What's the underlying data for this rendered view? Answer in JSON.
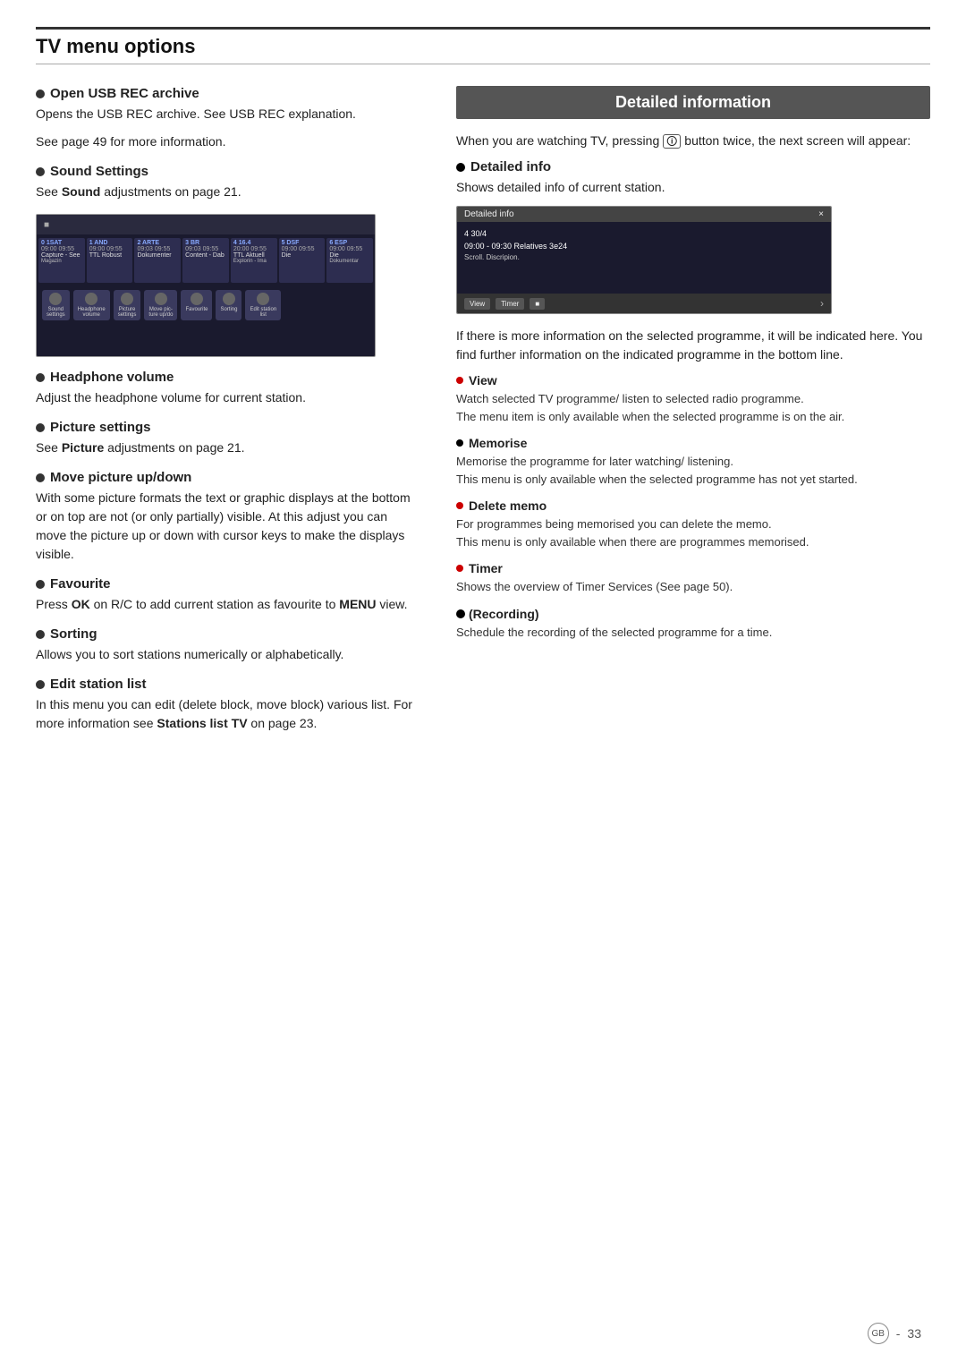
{
  "page": {
    "title": "TV menu options",
    "page_number": "33",
    "gb_label": "GB"
  },
  "left_column": {
    "open_usb": {
      "title": "Open USB REC archive",
      "text1": "Opens the USB REC archive. See USB REC explanation.",
      "text2": "See page 49 for more information."
    },
    "sound_settings": {
      "title": "Sound Settings",
      "text": "See Sound adjustments on page 21."
    },
    "headphone": {
      "title": "Headphone volume",
      "text": "Adjust the headphone volume for current station."
    },
    "picture_settings": {
      "title": "Picture settings",
      "text": "See Picture adjustments on page 21."
    },
    "move_picture": {
      "title": "Move picture up/down",
      "text": "With some picture formats the text or graphic displays at the bottom or on top are not (or only partially) visible. At this adjust you can move the picture up or down with cursor keys to make the displays visible."
    },
    "favourite": {
      "title": "Favourite",
      "text": "Press OK on R/C to add current station as favourite to MENU view.",
      "bold_word": "MENU"
    },
    "sorting": {
      "title": "Sorting",
      "text": "Allows you to sort stations numerically or alphabetically."
    },
    "edit_station": {
      "title": "Edit station list",
      "text1": "In this menu you can edit (delete block, move block) various list. For more information see ",
      "text_bold": "Stations list TV",
      "text2": " on page 23."
    },
    "tv_channels": [
      {
        "num": "0 1SAT",
        "time": "09:00 09:55",
        "sub": "Capture - See",
        "prog": "Magazin"
      },
      {
        "num": "1 AND",
        "time": "09:00 09:55",
        "sub": "TTL Robust",
        "prog": ""
      },
      {
        "num": "2 ARTE",
        "time": "09:03 09:55",
        "sub": "Dokumenter",
        "prog": ""
      },
      {
        "num": "3 BR",
        "time": "09:03 09:55",
        "sub": "Content - Dab",
        "prog": ""
      },
      {
        "num": "4 16.4",
        "time": "20:00 09:55",
        "sub": "TTL Aktuell",
        "prog": "Explorin- Ima"
      },
      {
        "num": "5 DSF",
        "time": "09:00 09:55",
        "sub": "Die",
        "prog": ""
      },
      {
        "num": "6 ESP",
        "time": "09:00 09:55",
        "sub": "Die",
        "prog": "Dokumentar"
      }
    ],
    "bottom_icons": [
      {
        "label": "Sound\nsettings"
      },
      {
        "label": "Headphone\nvolume"
      },
      {
        "label": "Picture\nsettings"
      },
      {
        "label": "Move pic-\nture up/do..."
      },
      {
        "label": "Favourite"
      },
      {
        "label": "Sorting"
      },
      {
        "label": "Edit station\nlist"
      }
    ]
  },
  "right_column": {
    "header": "Detailed information",
    "intro_text": "When you are watching TV, pressing  button twice, the next screen will appear:",
    "detailed_info": {
      "title": "Detailed info",
      "text": "Shows detailed info of current station.",
      "screen": {
        "titlebar": "Detailed info",
        "close": "×",
        "ch_number": "4 30/4",
        "time_info": "09:00 - 09:30 Relatives 3e24",
        "description": "Scroll. Discripion.",
        "btn1": "View",
        "btn2": "Timer",
        "arrow": "›"
      }
    },
    "more_info_text": "If there is more information on the selected programme, it will be indicated here. You find further information on the indicated programme in the bottom line.",
    "view": {
      "title": "View",
      "text1": "Watch selected TV programme/ listen to selected radio programme.",
      "text2": "The menu item is only available when the selected programme is on the air."
    },
    "memorise": {
      "title": "Memorise",
      "text1": "Memorise the programme for later watching/ listening.",
      "text2": "This menu is only available when the selected programme has not yet started."
    },
    "delete_memo": {
      "title": "Delete memo",
      "text1": "For programmes being memorised you can delete the memo.",
      "text2": "This menu is only available when there are programmes memorised."
    },
    "timer": {
      "title": "Timer",
      "text": "Shows the overview of Timer Services (See page 50)."
    },
    "recording": {
      "title": "(Recording)",
      "text": "Schedule the recording of the selected programme for a time."
    }
  }
}
